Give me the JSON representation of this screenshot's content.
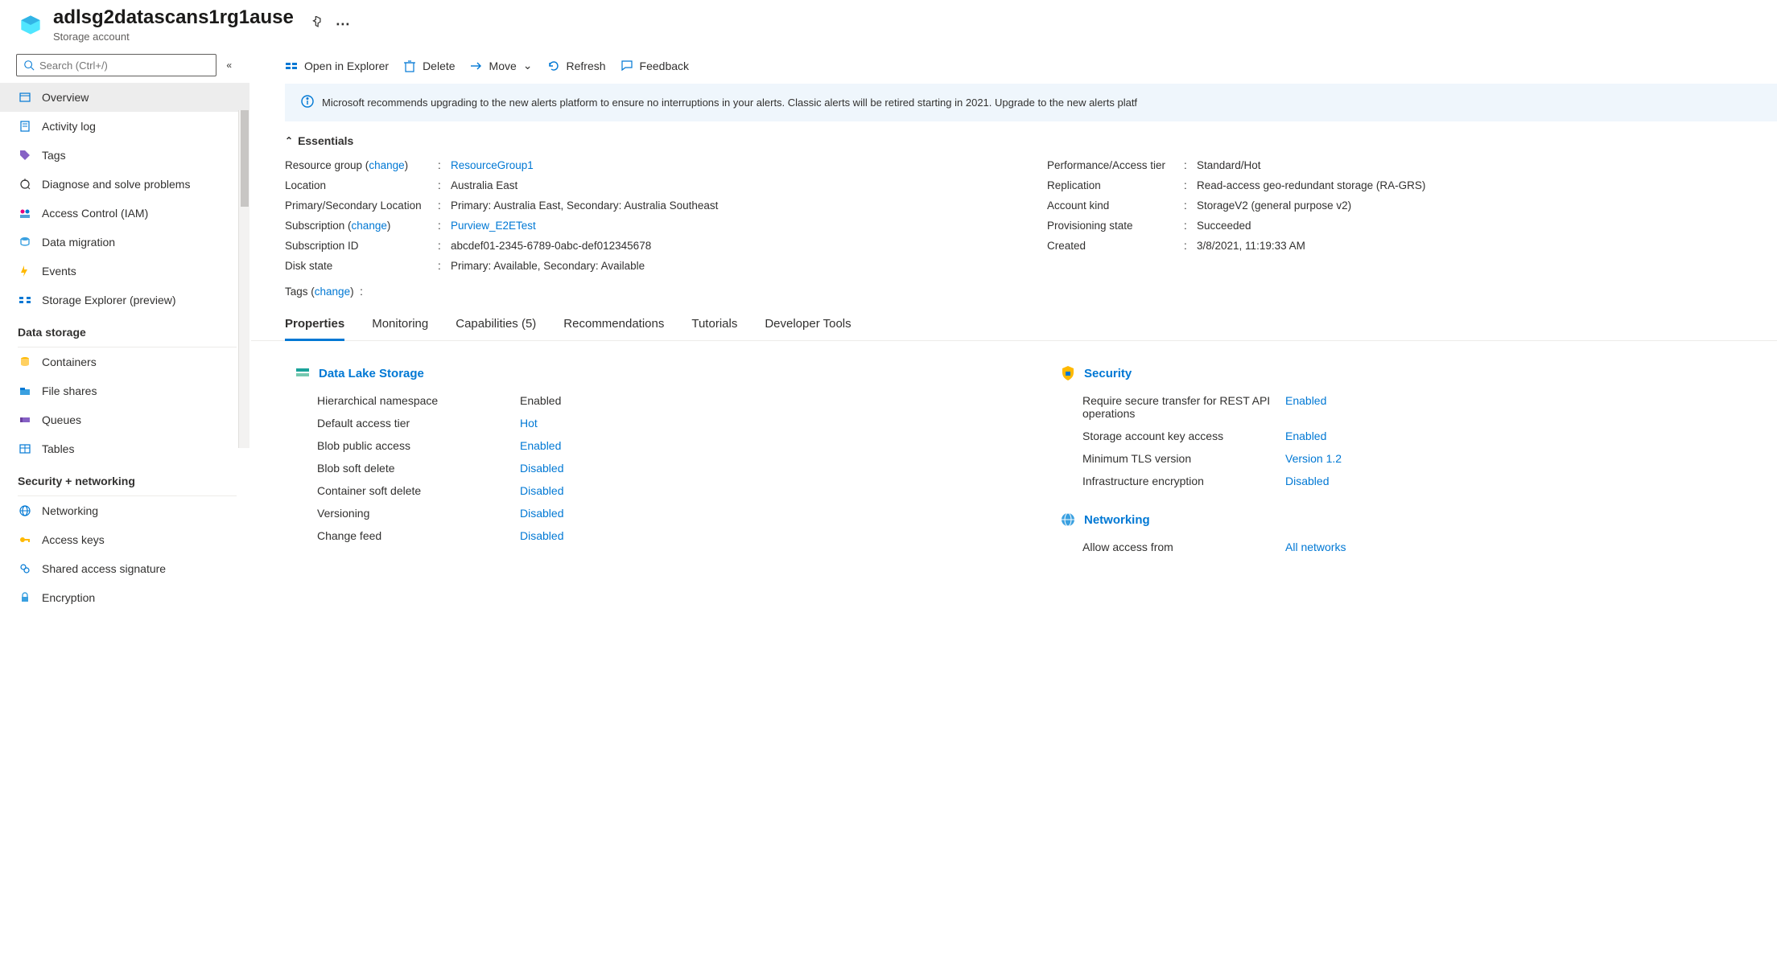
{
  "header": {
    "title": "adlsg2datascans1rg1ause",
    "subtitle": "Storage account"
  },
  "search": {
    "placeholder": "Search (Ctrl+/)"
  },
  "nav": {
    "top": [
      {
        "label": "Overview",
        "icon": "overview"
      },
      {
        "label": "Activity log",
        "icon": "activity"
      },
      {
        "label": "Tags",
        "icon": "tags"
      },
      {
        "label": "Diagnose and solve problems",
        "icon": "diagnose"
      },
      {
        "label": "Access Control (IAM)",
        "icon": "iam"
      },
      {
        "label": "Data migration",
        "icon": "migration"
      },
      {
        "label": "Events",
        "icon": "events"
      },
      {
        "label": "Storage Explorer (preview)",
        "icon": "explorer"
      }
    ],
    "sections": [
      {
        "title": "Data storage",
        "items": [
          {
            "label": "Containers",
            "icon": "containers"
          },
          {
            "label": "File shares",
            "icon": "fileshares"
          },
          {
            "label": "Queues",
            "icon": "queues"
          },
          {
            "label": "Tables",
            "icon": "tables"
          }
        ]
      },
      {
        "title": "Security + networking",
        "items": [
          {
            "label": "Networking",
            "icon": "networking"
          },
          {
            "label": "Access keys",
            "icon": "accesskeys"
          },
          {
            "label": "Shared access signature",
            "icon": "sas"
          },
          {
            "label": "Encryption",
            "icon": "encryption"
          }
        ]
      }
    ]
  },
  "toolbar": {
    "open_explorer": "Open in Explorer",
    "delete": "Delete",
    "move": "Move",
    "refresh": "Refresh",
    "feedback": "Feedback"
  },
  "banner": "Microsoft recommends upgrading to the new alerts platform to ensure no interruptions in your alerts. Classic alerts will be retired starting in 2021. Upgrade to the new alerts platf",
  "essentials": {
    "title": "Essentials",
    "left": [
      {
        "label": "Resource group",
        "change": "change",
        "value": "ResourceGroup1",
        "link": true
      },
      {
        "label": "Location",
        "value": "Australia East"
      },
      {
        "label": "Primary/Secondary Location",
        "value": "Primary: Australia East, Secondary: Australia Southeast"
      },
      {
        "label": "Subscription",
        "change": "change",
        "value": "Purview_E2ETest",
        "link": true
      },
      {
        "label": "Subscription ID",
        "value": "abcdef01-2345-6789-0abc-def012345678"
      },
      {
        "label": "Disk state",
        "value": "Primary: Available, Secondary: Available"
      }
    ],
    "right": [
      {
        "label": "Performance/Access tier",
        "value": "Standard/Hot"
      },
      {
        "label": "Replication",
        "value": "Read-access geo-redundant storage (RA-GRS)"
      },
      {
        "label": "Account kind",
        "value": "StorageV2 (general purpose v2)"
      },
      {
        "label": "Provisioning state",
        "value": "Succeeded"
      },
      {
        "label": "Created",
        "value": "3/8/2021, 11:19:33 AM"
      }
    ],
    "tags_label": "Tags",
    "tags_change": "change"
  },
  "tabs": [
    "Properties",
    "Monitoring",
    "Capabilities (5)",
    "Recommendations",
    "Tutorials",
    "Developer Tools"
  ],
  "properties": {
    "left": {
      "title": "Data Lake Storage",
      "rows": [
        {
          "label": "Hierarchical namespace",
          "value": "Enabled",
          "link": false
        },
        {
          "label": "Default access tier",
          "value": "Hot",
          "link": true
        },
        {
          "label": "Blob public access",
          "value": "Enabled",
          "link": true
        },
        {
          "label": "Blob soft delete",
          "value": "Disabled",
          "link": true
        },
        {
          "label": "Container soft delete",
          "value": "Disabled",
          "link": true
        },
        {
          "label": "Versioning",
          "value": "Disabled",
          "link": true
        },
        {
          "label": "Change feed",
          "value": "Disabled",
          "link": true
        }
      ]
    },
    "right": [
      {
        "title": "Security",
        "rows": [
          {
            "label": "Require secure transfer for REST API operations",
            "value": "Enabled",
            "link": true
          },
          {
            "label": "Storage account key access",
            "value": "Enabled",
            "link": true
          },
          {
            "label": "Minimum TLS version",
            "value": "Version 1.2",
            "link": true
          },
          {
            "label": "Infrastructure encryption",
            "value": "Disabled",
            "link": true
          }
        ]
      },
      {
        "title": "Networking",
        "rows": [
          {
            "label": "Allow access from",
            "value": "All networks",
            "link": true
          }
        ]
      }
    ]
  }
}
